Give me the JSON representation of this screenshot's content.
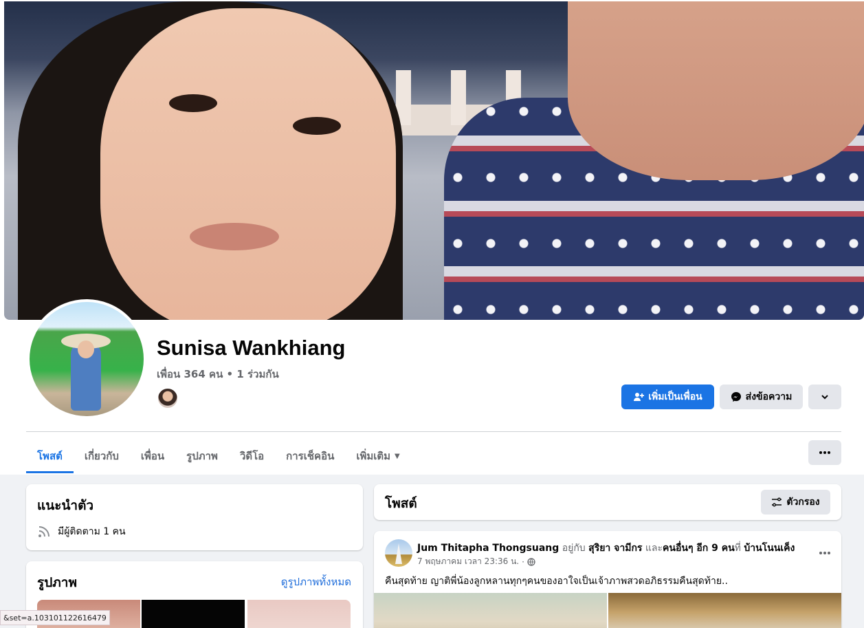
{
  "profile": {
    "name": "Sunisa Wankhiang",
    "friends_summary": "เพื่อน 364 คน • 1 ร่วมกัน"
  },
  "actions": {
    "add_friend": "เพิ่มเป็นเพื่อน",
    "message": "ส่งข้อความ"
  },
  "tabs": [
    {
      "label": "โพสต์",
      "active": true
    },
    {
      "label": "เกี่ยวกับ"
    },
    {
      "label": "เพื่อน"
    },
    {
      "label": "รูปภาพ"
    },
    {
      "label": "วิดีโอ"
    },
    {
      "label": "การเช็คอิน"
    },
    {
      "label": "เพิ่มเติม"
    }
  ],
  "intro": {
    "title": "แนะนำตัว",
    "followers": "มีผู้ติดตาม 1 คน"
  },
  "photos": {
    "title": "รูปภาพ",
    "see_all": "ดูรูปภาพทั้งหมด"
  },
  "posts": {
    "title": "โพสต์",
    "filter": "ตัวกรอง"
  },
  "post": {
    "author": "Jum Thitapha Thongsuang",
    "with_text": "อยู่กับ",
    "tagged": "สุริยา จามีกร",
    "and_text": "และ",
    "others": "คนอื่นๆ อีก 9 คน",
    "at_text": "ที่",
    "location": "บ้านโนนเค็ง",
    "timestamp": "7 พฤษภาคม เวลา 23:36 น.",
    "text": "คืนสุดท้าย ญาติพี่น้องลูกหลานทุกๆคนของอาใจเป็นเจ้าภาพสวดอภิธรรมคืนสุดท้าย.."
  },
  "status_bar": {
    "url": "&set=a.103101122616479"
  },
  "colors": {
    "accent": "#1b74e4",
    "background": "#f0f2f5"
  }
}
